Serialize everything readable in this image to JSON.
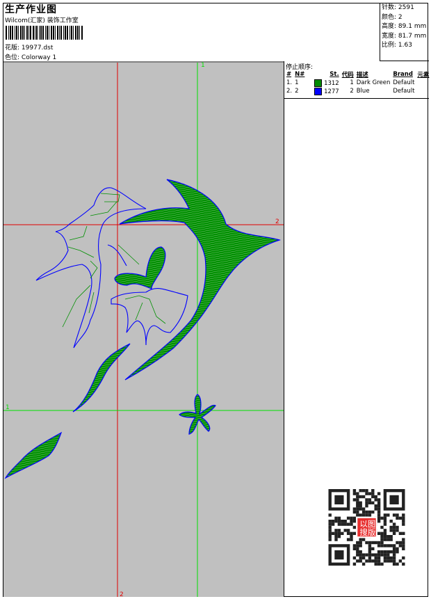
{
  "header": {
    "title": "生产作业图",
    "company": "Wilcom(汇家) 装饰工作室",
    "design_label": "花版:",
    "design_file": "19977.dst",
    "colorway_label": "色位:",
    "colorway": "Colorway 1"
  },
  "info": [
    {
      "label": "针数:",
      "value": "2591"
    },
    {
      "label": "颜色:",
      "value": "2"
    },
    {
      "label": "高度:",
      "value": "89.1 mm"
    },
    {
      "label": "宽度:",
      "value": "81.7 mm"
    },
    {
      "label": "比例:",
      "value": "1.63"
    }
  ],
  "stop_sequence": {
    "title": "停止顺序:",
    "columns": [
      "#",
      "N#",
      "St.",
      "代码",
      "描述",
      "Brand",
      "元素"
    ],
    "rows": [
      {
        "idx": "1.",
        "n": "1",
        "color": "#008c00",
        "st": "1312",
        "code": "1",
        "desc": "Dark Green",
        "brand": "Default"
      },
      {
        "idx": "2.",
        "n": "2",
        "color": "#0000ff",
        "st": "1277",
        "code": "2",
        "desc": "Blue",
        "brand": "Default"
      }
    ]
  },
  "guides": {
    "v_green": "1",
    "h_red": "2",
    "h_green": "1",
    "v_red": "2"
  },
  "qr_stamp": "以图搜版",
  "colors": {
    "fill": "#009000",
    "outline": "#0000ff",
    "guide_green": "#00e000",
    "guide_red": "#e00000",
    "canvas": "#c0c0c0"
  }
}
